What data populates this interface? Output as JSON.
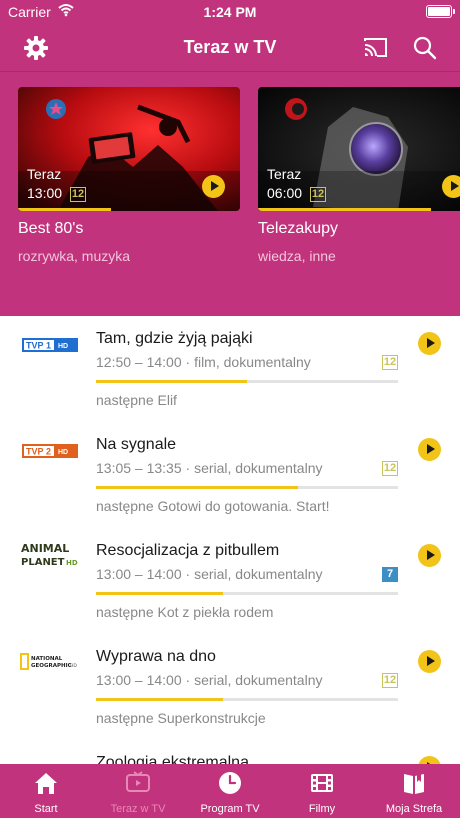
{
  "status_bar": {
    "carrier": "Carrier",
    "time": "1:24 PM"
  },
  "navbar": {
    "title": "Teraz w TV",
    "icons": [
      "gear-icon",
      "cast-icon",
      "search-icon"
    ]
  },
  "featured": [
    {
      "now_label": "Teraz",
      "time": "13:00",
      "age": "12",
      "name": "Best 80's",
      "categories": "rozrywka, muzyka",
      "progress": 0.42
    },
    {
      "now_label": "Teraz",
      "time": "06:00",
      "age": "12",
      "name": "Telezakupy",
      "categories": "wiedza, inne",
      "progress": 0.78
    }
  ],
  "listings": [
    {
      "channel": "TVP 1 HD",
      "title": "Tam, gdzie żyją pająki",
      "meta": "12:50 – 14:00 · film, dokumentalny",
      "age": "12",
      "progress": 0.5,
      "next": "następne Elif"
    },
    {
      "channel": "TVP 2 HD",
      "title": "Na sygnale",
      "meta": "13:05 – 13:35 · serial, dokumentalny",
      "age": "12",
      "progress": 0.67,
      "next": "następne Gotowi do gotowania. Start!"
    },
    {
      "channel": "Animal Planet HD",
      "title": "Resocjalizacja z pitbullem",
      "meta": "13:00 – 14:00 · serial, dokumentalny",
      "age": "7",
      "progress": 0.42,
      "next": "następne Kot z piekła rodem"
    },
    {
      "channel": "National Geographic HD",
      "title": "Wyprawa na dno",
      "meta": "13:00 – 14:00 · serial, dokumentalny",
      "age": "12",
      "progress": 0.42,
      "next": "następne Superkonstrukcje"
    },
    {
      "channel": "",
      "title": "Zoologia ekstremalna",
      "meta": "",
      "age": "",
      "progress": 0,
      "next": ""
    }
  ],
  "tabs": [
    {
      "label": "Start",
      "icon": "home-icon"
    },
    {
      "label": "Teraz w TV",
      "icon": "tv-now-icon",
      "active": true
    },
    {
      "label": "Program TV",
      "icon": "clock-icon"
    },
    {
      "label": "Filmy",
      "icon": "film-icon"
    },
    {
      "label": "Moja Strefa",
      "icon": "book-icon"
    }
  ],
  "colors": {
    "brand": "#c2337d",
    "accent": "#f2c418",
    "age12": "#c8c45a",
    "age7": "#3a8fc6"
  }
}
